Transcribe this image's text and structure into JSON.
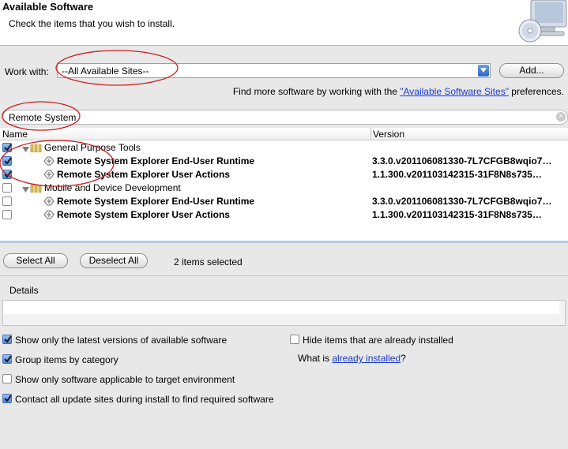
{
  "header": {
    "title": "Available Software",
    "subtitle": "Check the items that you wish to install.",
    "graphic_icon": "monitor-cd-icon"
  },
  "work_with": {
    "label": "Work with:",
    "value": "--All Available Sites--",
    "add_button": "Add...",
    "more_prefix": "Find more software by working with the ",
    "more_link": "\"Available Software Sites\"",
    "more_suffix": " preferences."
  },
  "filter": {
    "value": "Remote System",
    "clear_icon": "clear-search-icon"
  },
  "table": {
    "columns": [
      "Name",
      "Version"
    ],
    "rows": [
      {
        "type": "category",
        "label": "General Purpose Tools",
        "checked": true
      },
      {
        "type": "feature",
        "label": "Remote System Explorer End-User Runtime",
        "version": "3.3.0.v201106081330-7L7CFGB8wqio7…",
        "checked": true
      },
      {
        "type": "feature",
        "label": "Remote System Explorer User Actions",
        "version": "1.1.300.v201103142315-31F8N8s735…",
        "checked": true
      },
      {
        "type": "category",
        "label": "Mobile and Device Development",
        "checked": false
      },
      {
        "type": "feature",
        "label": "Remote System Explorer End-User Runtime",
        "version": "3.3.0.v201106081330-7L7CFGB8wqio7…",
        "checked": false
      },
      {
        "type": "feature",
        "label": "Remote System Explorer User Actions",
        "version": "1.1.300.v201103142315-31F8N8s735…",
        "checked": false
      }
    ]
  },
  "selection": {
    "select_all": "Select All",
    "deselect_all": "Deselect All",
    "status": "2 items selected"
  },
  "details": {
    "label": "Details"
  },
  "options": {
    "latest": {
      "label": "Show only the latest versions of available software",
      "checked": true
    },
    "group": {
      "label": "Group items by category",
      "checked": true
    },
    "target": {
      "label": "Show only software applicable to target environment",
      "checked": false
    },
    "contact": {
      "label": "Contact all update sites during install to find required software",
      "checked": true
    },
    "hide": {
      "label": "Hide items that are already installed",
      "checked": false
    },
    "what_is_prefix": "What is ",
    "what_is_link": "already installed",
    "what_is_suffix": "?"
  },
  "colors": {
    "annotation": "#cc1d1d",
    "link": "#1a3acf",
    "checkbox_checked": "#4e86dc"
  }
}
